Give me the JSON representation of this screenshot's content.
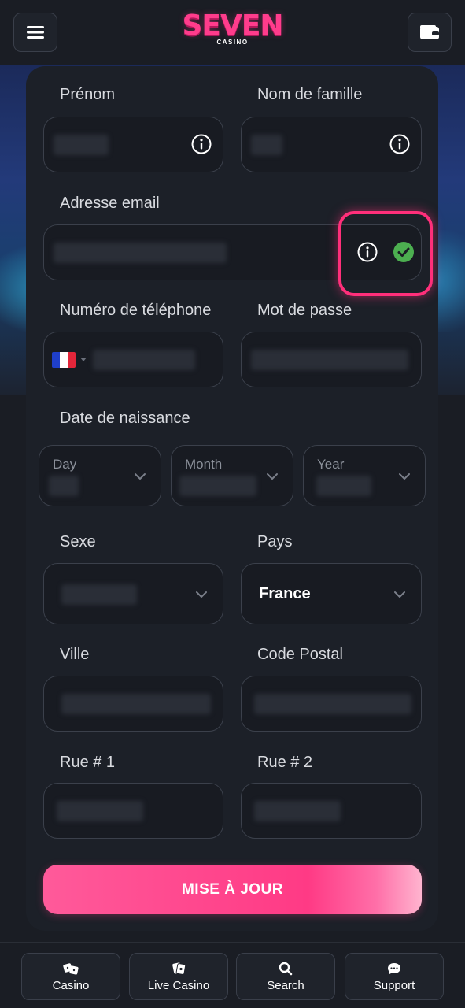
{
  "header": {
    "logo_text": "SEVEN",
    "logo_sub": "CASINO"
  },
  "form": {
    "first_name": {
      "label": "Prénom"
    },
    "last_name": {
      "label": "Nom de famille"
    },
    "email": {
      "label": "Adresse email"
    },
    "phone": {
      "label": "Numéro de téléphone"
    },
    "password": {
      "label": "Mot de passe"
    },
    "dob": {
      "label": "Date de naissance",
      "day_label": "Day",
      "month_label": "Month",
      "year_label": "Year"
    },
    "gender": {
      "label": "Sexe"
    },
    "country": {
      "label": "Pays",
      "value": "France"
    },
    "city": {
      "label": "Ville"
    },
    "postal_code": {
      "label": "Code Postal"
    },
    "street1": {
      "label": "Rue # 1"
    },
    "street2": {
      "label": "Rue # 2"
    },
    "submit_label": "MISE À JOUR"
  },
  "bottom_nav": [
    {
      "label": "Casino",
      "icon": "dice-icon"
    },
    {
      "label": "Live Casino",
      "icon": "cards-icon"
    },
    {
      "label": "Search",
      "icon": "search-icon"
    },
    {
      "label": "Support",
      "icon": "chat-icon"
    }
  ],
  "colors": {
    "accent": "#ff3a85",
    "success": "#4caf50",
    "background": "#1a1d24"
  }
}
